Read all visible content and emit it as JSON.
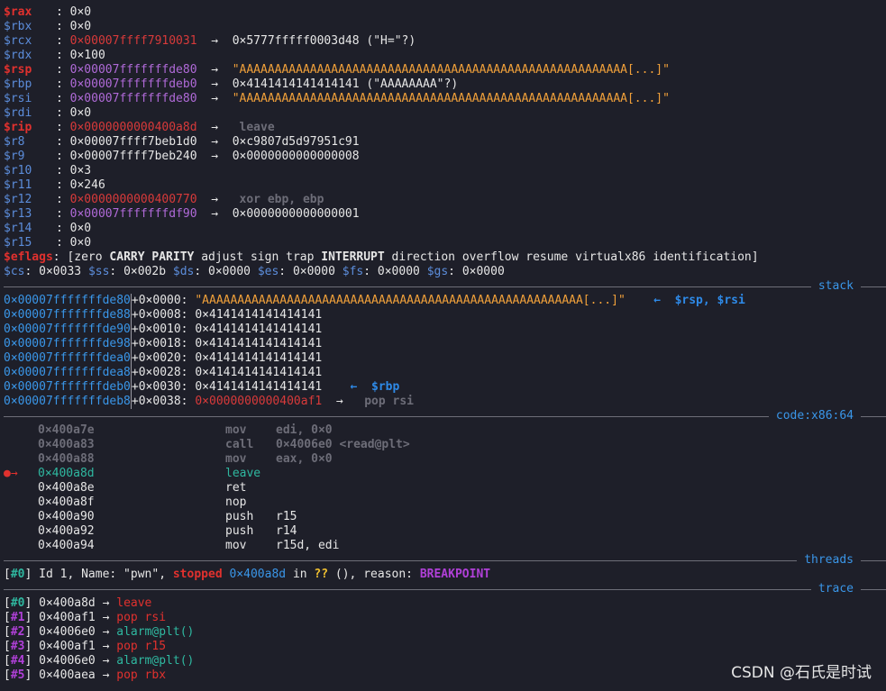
{
  "registers": [
    {
      "name": "$rax",
      "changed": true,
      "value": "0×0",
      "value_class": "white"
    },
    {
      "name": "$rbx",
      "changed": false,
      "value": "0×0",
      "value_class": "white"
    },
    {
      "name": "$rcx",
      "changed": false,
      "value": "0×00007ffff7910031",
      "value_class": "addr-red",
      "deref": "0×5777fffff0003d48",
      "deref_class": "white",
      "suffix": "(\"H=\"?)",
      "suffix_class": "white"
    },
    {
      "name": "$rdx",
      "changed": false,
      "value": "0×100",
      "value_class": "white"
    },
    {
      "name": "$rsp",
      "changed": true,
      "value": "0×00007fffffffde80",
      "value_class": "addr-purple",
      "deref": "\"AAAAAAAAAAAAAAAAAAAAAAAAAAAAAAAAAAAAAAAAAAAAAAAAAAAAAAA[...]\"",
      "deref_class": "str-orange"
    },
    {
      "name": "$rbp",
      "changed": false,
      "value": "0×00007fffffffdeb0",
      "value_class": "addr-purple",
      "deref": "0×4141414141414141",
      "deref_class": "white",
      "suffix": "(\"AAAAAAAA\"?)",
      "suffix_class": "white"
    },
    {
      "name": "$rsi",
      "changed": false,
      "value": "0×00007fffffffde80",
      "value_class": "addr-purple",
      "deref": "\"AAAAAAAAAAAAAAAAAAAAAAAAAAAAAAAAAAAAAAAAAAAAAAAAAAAAAAA[...]\"",
      "deref_class": "str-orange"
    },
    {
      "name": "$rdi",
      "changed": false,
      "value": "0×0",
      "value_class": "white"
    },
    {
      "name": "$rip",
      "changed": true,
      "value": "0×0000000000400a8d",
      "value_class": "addr-red",
      "deref": " leave",
      "deref_class": "dim"
    },
    {
      "name": "$r8",
      "changed": false,
      "value": "0×00007ffff7beb1d0",
      "value_class": "white",
      "deref": "0×c9807d5d97951c91",
      "deref_class": "white"
    },
    {
      "name": "$r9",
      "changed": false,
      "value": "0×00007ffff7beb240",
      "value_class": "white",
      "deref": "0×0000000000000008",
      "deref_class": "white"
    },
    {
      "name": "$r10",
      "changed": false,
      "value": "0×3",
      "value_class": "white"
    },
    {
      "name": "$r11",
      "changed": false,
      "value": "0×246",
      "value_class": "white"
    },
    {
      "name": "$r12",
      "changed": false,
      "value": "0×0000000000400770",
      "value_class": "addr-red",
      "deref": " xor ebp, ebp",
      "deref_class": "dim"
    },
    {
      "name": "$r13",
      "changed": false,
      "value": "0×00007fffffffdf90",
      "value_class": "addr-purple",
      "deref": "0×0000000000000001",
      "deref_class": "white"
    },
    {
      "name": "$r14",
      "changed": false,
      "value": "0×0",
      "value_class": "white"
    },
    {
      "name": "$r15",
      "changed": false,
      "value": "0×0",
      "value_class": "white"
    }
  ],
  "eflags": {
    "label": "$eflags",
    "open": ": [",
    "flags": [
      {
        "t": "zero",
        "b": false
      },
      {
        "t": "CARRY",
        "b": true
      },
      {
        "t": "PARITY",
        "b": true
      },
      {
        "t": "adjust",
        "b": false
      },
      {
        "t": "sign",
        "b": false
      },
      {
        "t": "trap",
        "b": false
      },
      {
        "t": "INTERRUPT",
        "b": true
      },
      {
        "t": "direction",
        "b": false
      },
      {
        "t": "overflow",
        "b": false
      },
      {
        "t": "resume",
        "b": false
      },
      {
        "t": "virtualx86",
        "b": false
      },
      {
        "t": "identification",
        "b": false
      }
    ],
    "close": "]"
  },
  "segments": [
    {
      "name": "$cs",
      "value": "0×0033"
    },
    {
      "name": "$ss",
      "value": "0×002b"
    },
    {
      "name": "$ds",
      "value": "0×0000"
    },
    {
      "name": "$es",
      "value": "0×0000"
    },
    {
      "name": "$fs",
      "value": "0×0000"
    },
    {
      "name": "$gs",
      "value": "0×0000"
    }
  ],
  "sections": {
    "stack": "stack",
    "code": "code:x86:64",
    "threads": "threads",
    "trace": "trace"
  },
  "stack": [
    {
      "addr": "0×00007fffffffde80",
      "off": "+0×0000:",
      "val": "\"AAAAAAAAAAAAAAAAAAAAAAAAAAAAAAAAAAAAAAAAAAAAAAAAAAAAAA[...]\"",
      "val_class": "str-orange",
      "note": "←  $rsp, $rsi"
    },
    {
      "addr": "0×00007fffffffde88",
      "off": "+0×0008:",
      "val": "0×4141414141414141",
      "val_class": "white"
    },
    {
      "addr": "0×00007fffffffde90",
      "off": "+0×0010:",
      "val": "0×4141414141414141",
      "val_class": "white"
    },
    {
      "addr": "0×00007fffffffde98",
      "off": "+0×0018:",
      "val": "0×4141414141414141",
      "val_class": "white"
    },
    {
      "addr": "0×00007fffffffdea0",
      "off": "+0×0020:",
      "val": "0×4141414141414141",
      "val_class": "white"
    },
    {
      "addr": "0×00007fffffffdea8",
      "off": "+0×0028:",
      "val": "0×4141414141414141",
      "val_class": "white"
    },
    {
      "addr": "0×00007fffffffdeb0",
      "off": "+0×0030:",
      "val": "0×4141414141414141",
      "val_class": "white",
      "note": "←  $rbp"
    },
    {
      "addr": "0×00007fffffffdeb8",
      "off": "+0×0038:",
      "val": "0×0000000000400af1",
      "val_class": "addr-red",
      "deref": "pop rsi"
    }
  ],
  "code": [
    {
      "addr": "0×400a7e",
      "mn": "mov",
      "ops": "edi, 0×0",
      "style": "past"
    },
    {
      "addr": "0×400a83",
      "mn": "call",
      "ops": "0×4006e0 <read@plt>",
      "style": "past"
    },
    {
      "addr": "0×400a88",
      "mn": "mov",
      "ops": "eax, 0×0",
      "style": "past"
    },
    {
      "addr": "0×400a8d",
      "mn": "leave",
      "ops": "",
      "style": "current",
      "marker": "●→"
    },
    {
      "addr": "0×400a8e",
      "mn": "ret",
      "ops": "",
      "style": "next"
    },
    {
      "addr": "0×400a8f",
      "mn": "nop",
      "ops": "",
      "style": "next"
    },
    {
      "addr": "0×400a90",
      "mn": "push",
      "ops": "r15",
      "style": "next"
    },
    {
      "addr": "0×400a92",
      "mn": "push",
      "ops": "r14",
      "style": "next"
    },
    {
      "addr": "0×400a94",
      "mn": "mov",
      "ops": "r15d, edi",
      "style": "next"
    }
  ],
  "thread": {
    "idx": "#0",
    "pre": "Id 1, Name: \"pwn\",",
    "status": "stopped",
    "addr": "0×400a8d",
    "in": "in",
    "func": "??",
    "mid": "(), reason:",
    "reason": "BREAKPOINT"
  },
  "trace": [
    {
      "idx": "#0",
      "addr": "0×400a8d",
      "sym": "leave",
      "cls": "redtxt"
    },
    {
      "idx": "#1",
      "addr": "0×400af1",
      "sym": "pop rsi",
      "cls": "redtxt"
    },
    {
      "idx": "#2",
      "addr": "0×4006e0",
      "sym": "alarm@plt()",
      "cls": "green"
    },
    {
      "idx": "#3",
      "addr": "0×400af1",
      "sym": "pop r15",
      "cls": "redtxt"
    },
    {
      "idx": "#4",
      "addr": "0×4006e0",
      "sym": "alarm@plt()",
      "cls": "green"
    },
    {
      "idx": "#5",
      "addr": "0×400aea",
      "sym": "pop rbx",
      "cls": "redtxt"
    }
  ],
  "watermark": "CSDN @石氏是时试"
}
